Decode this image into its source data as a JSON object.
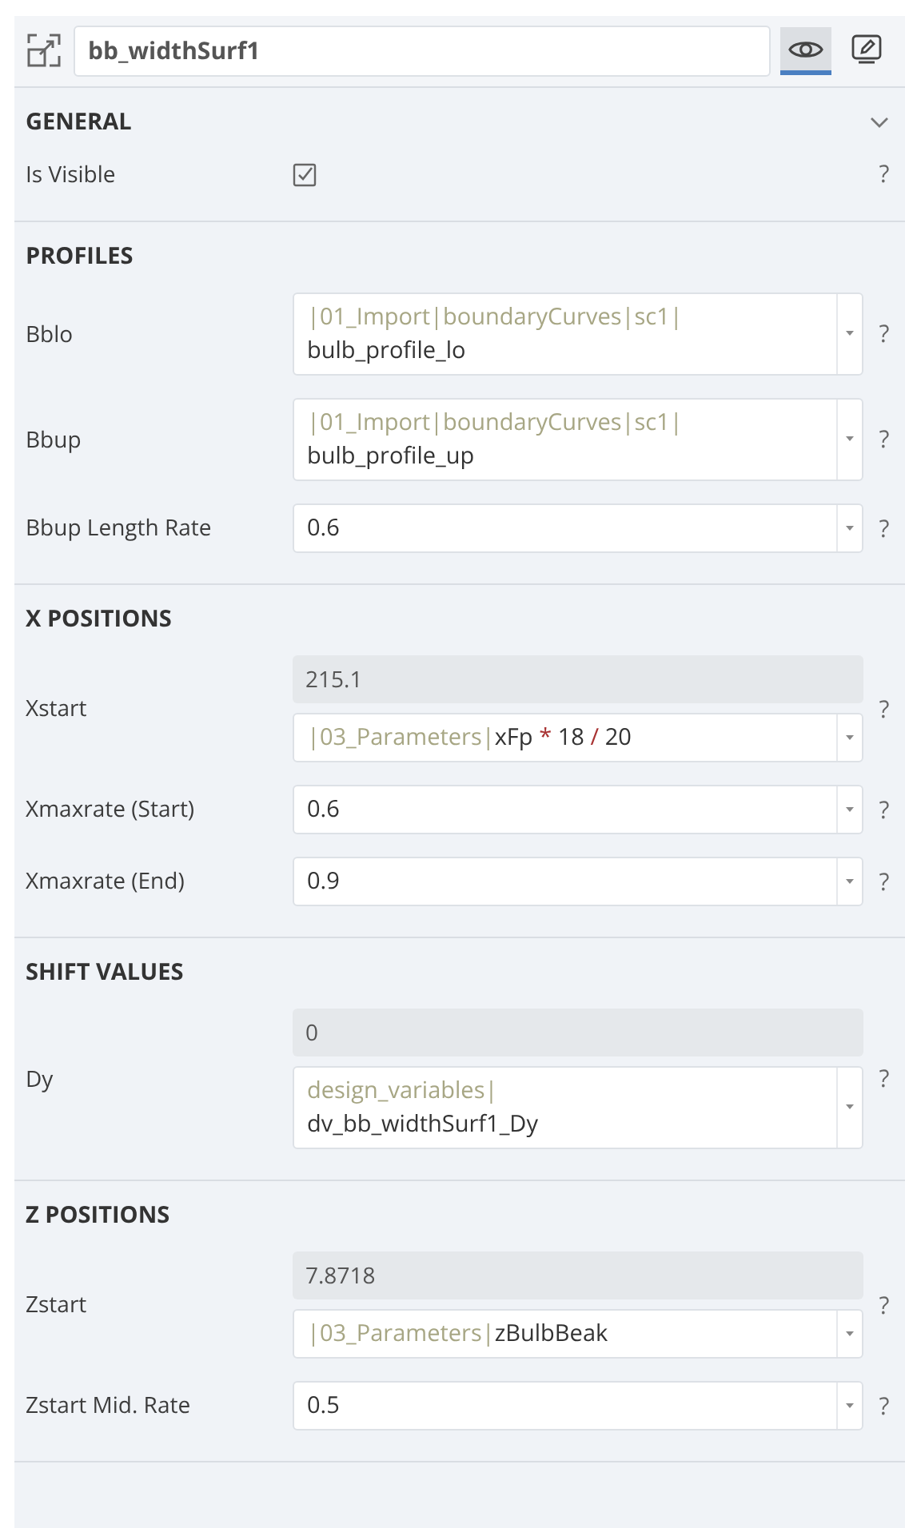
{
  "header": {
    "name": "bb_widthSurf1",
    "view_selected": true,
    "edit_selected": false
  },
  "sections": [
    {
      "title": "GENERAL",
      "expanded": true,
      "rows": [
        {
          "kind": "checkbox",
          "label": "Is Visible",
          "checked": true,
          "help": "?"
        }
      ]
    },
    {
      "title": "PROFILES",
      "rows": [
        {
          "kind": "field",
          "label": "Bblo",
          "help": "?",
          "lines": [
            [
              {
                "kind": "path",
                "text": "|01_Import|boundaryCurves|sc1|"
              }
            ],
            [
              {
                "kind": "name",
                "text": "bulb_profile_lo"
              }
            ]
          ]
        },
        {
          "kind": "field",
          "label": "Bbup",
          "help": "?",
          "lines": [
            [
              {
                "kind": "path",
                "text": "|01_Import|boundaryCurves|sc1|"
              }
            ],
            [
              {
                "kind": "name",
                "text": "bulb_profile_up"
              }
            ]
          ]
        },
        {
          "kind": "field",
          "label": "Bbup Length Rate",
          "help": "?",
          "lines": [
            [
              {
                "kind": "name",
                "text": "0.6"
              }
            ]
          ]
        }
      ]
    },
    {
      "title": "X POSITIONS",
      "rows": [
        {
          "kind": "computed",
          "label": "Xstart",
          "help": "?",
          "result": "215.1",
          "lines": [
            [
              {
                "kind": "path",
                "text": "|03_Parameters|"
              },
              {
                "kind": "name",
                "text": "xFp"
              },
              {
                "kind": "op",
                "text": "*"
              },
              {
                "kind": "name",
                "text": "18"
              },
              {
                "kind": "op",
                "text": "/"
              },
              {
                "kind": "name",
                "text": "20"
              }
            ]
          ]
        },
        {
          "kind": "field",
          "label": "Xmaxrate (Start)",
          "help": "?",
          "lines": [
            [
              {
                "kind": "name",
                "text": "0.6"
              }
            ]
          ]
        },
        {
          "kind": "field",
          "label": "Xmaxrate (End)",
          "help": "?",
          "lines": [
            [
              {
                "kind": "name",
                "text": "0.9"
              }
            ]
          ]
        }
      ]
    },
    {
      "title": "SHIFT VALUES",
      "rows": [
        {
          "kind": "computed",
          "label": "Dy",
          "help": "?",
          "result": "0",
          "lines": [
            [
              {
                "kind": "path",
                "text": "design_variables|"
              }
            ],
            [
              {
                "kind": "name",
                "text": "dv_bb_widthSurf1_Dy"
              }
            ]
          ]
        }
      ]
    },
    {
      "title": "Z POSITIONS",
      "rows": [
        {
          "kind": "computed",
          "label": "Zstart",
          "help": "?",
          "result": "7.8718",
          "lines": [
            [
              {
                "kind": "path",
                "text": "|03_Parameters|"
              },
              {
                "kind": "name",
                "text": "zBulbBeak"
              }
            ]
          ]
        },
        {
          "kind": "field",
          "label": "Zstart Mid. Rate",
          "help": "?",
          "lines": [
            [
              {
                "kind": "name",
                "text": "0.5"
              }
            ]
          ]
        }
      ]
    }
  ]
}
